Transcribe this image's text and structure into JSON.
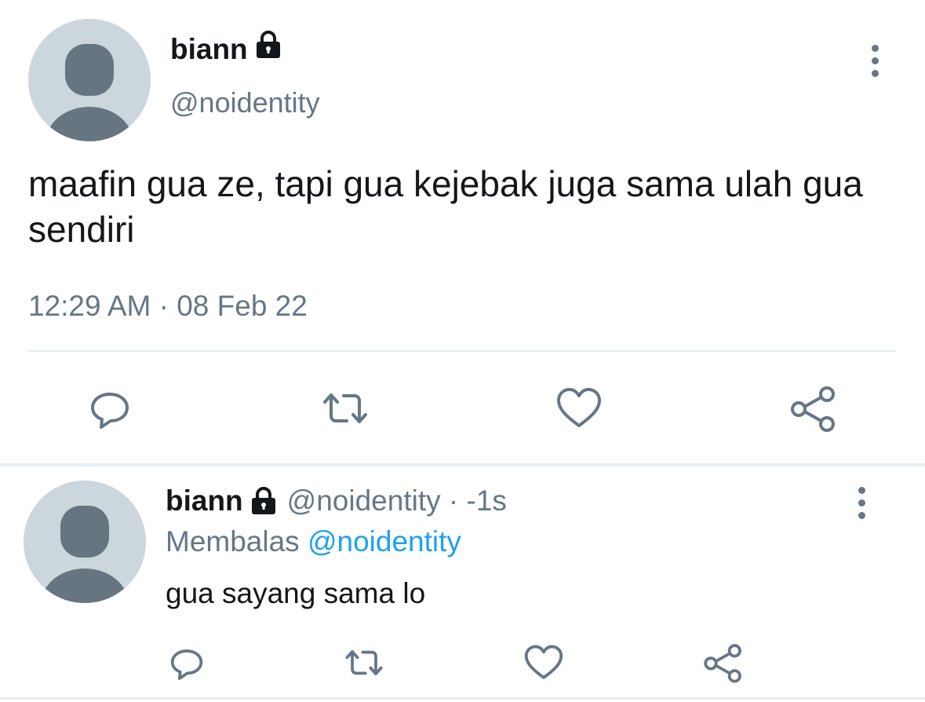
{
  "main_tweet": {
    "name": "biann",
    "handle": "@noidentity",
    "text": "maafin gua ze, tapi gua kejebak juga sama ulah gua sendiri",
    "timestamp": "12:29 AM · 08 Feb 22",
    "icons": {
      "lock": "lock-icon",
      "menu": "more-vertical-icon",
      "reply": "reply-icon",
      "retweet": "retweet-icon",
      "like": "heart-icon",
      "share": "share-icon"
    }
  },
  "reply_tweet": {
    "name": "biann",
    "handle_time": "@noidentity · -1s",
    "replying_prefix": "Membalas",
    "replying_mention": "@noidentity",
    "text": "gua sayang sama lo"
  },
  "colors": {
    "text_primary": "#14171a",
    "text_secondary": "#657786",
    "accent": "#1da1f2",
    "divider": "#e6ecf0",
    "avatar_bg": "#ccd6dd",
    "avatar_fg": "#66757f"
  }
}
